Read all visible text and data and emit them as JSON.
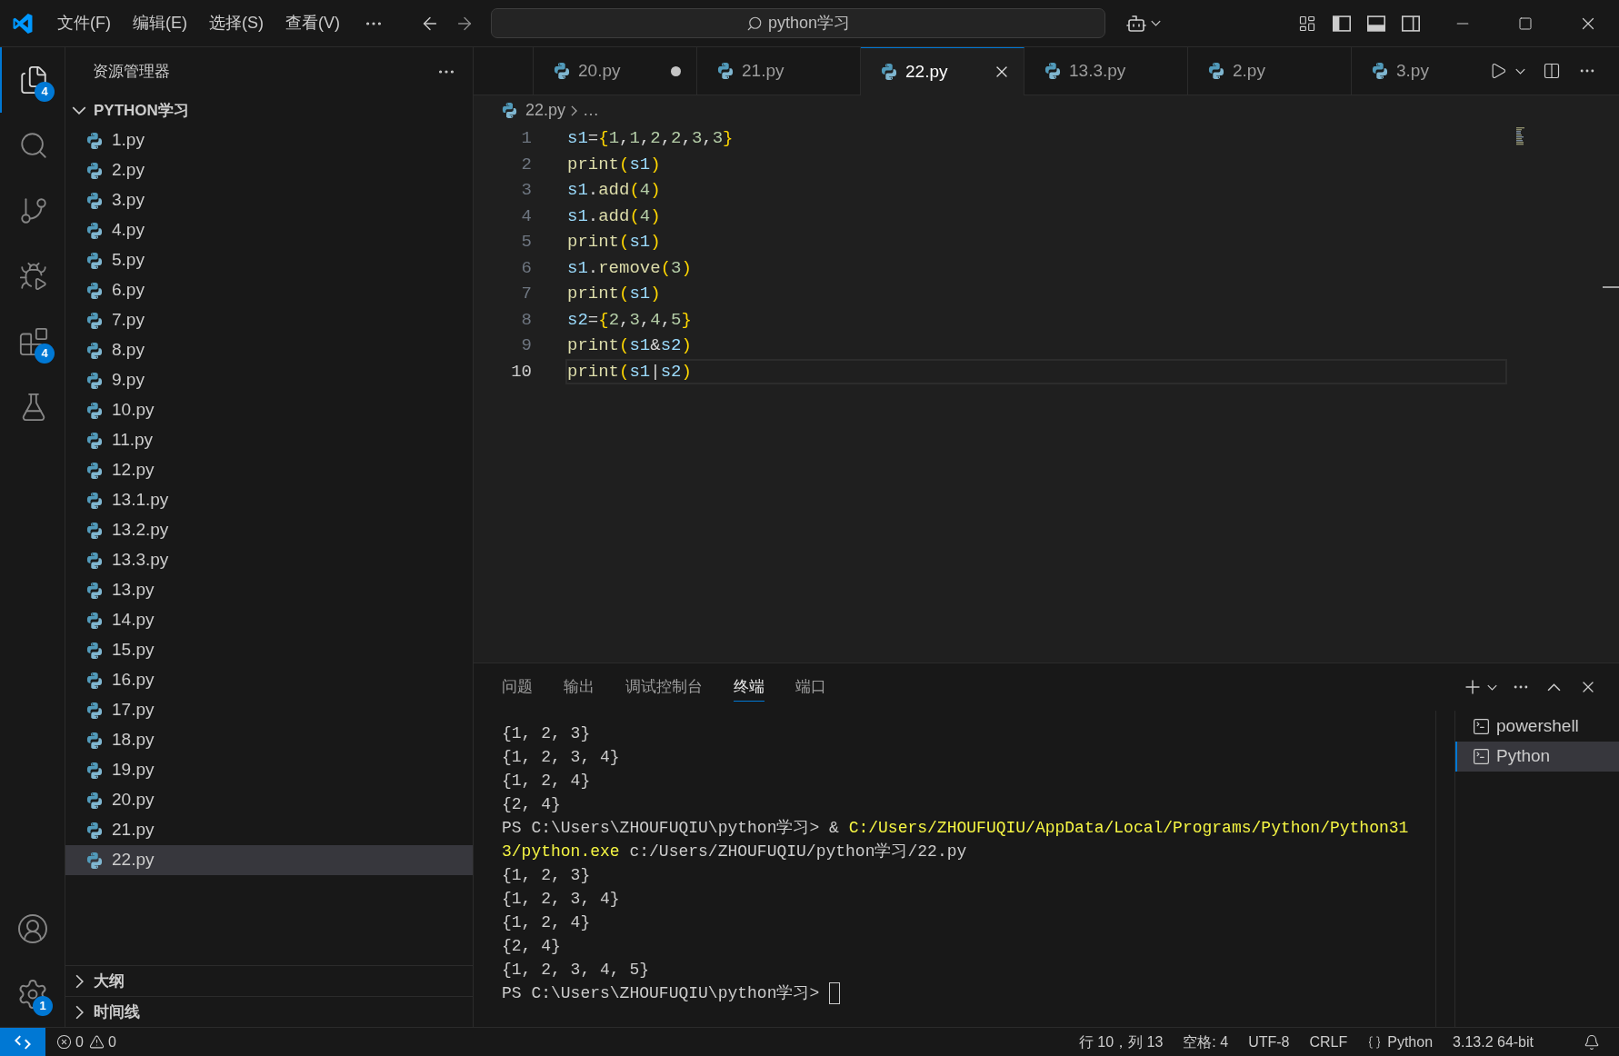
{
  "title_bar": {
    "menus": [
      "文件(F)",
      "编辑(E)",
      "选择(S)",
      "查看(V)"
    ],
    "command_center": {
      "label": "python学习"
    },
    "layout_toggles": {
      "primary_sidebar": true,
      "panel": true,
      "secondary_sidebar": false
    }
  },
  "activity_bar": {
    "items": [
      {
        "selected": true,
        "badge": "4"
      },
      {
        "selected": false
      },
      {
        "selected": false
      },
      {
        "selected": false
      },
      {
        "selected": false,
        "badge": "4"
      },
      {
        "selected": false
      }
    ],
    "settings_badge": "1"
  },
  "sidebar": {
    "title": "资源管理器",
    "folder": {
      "name": "PYTHON学习",
      "expanded": true,
      "children": [
        {
          "name": "1.py",
          "selected": false
        },
        {
          "name": "2.py",
          "selected": false
        },
        {
          "name": "3.py",
          "selected": false
        },
        {
          "name": "4.py",
          "selected": false
        },
        {
          "name": "5.py",
          "selected": false
        },
        {
          "name": "6.py",
          "selected": false
        },
        {
          "name": "7.py",
          "selected": false
        },
        {
          "name": "8.py",
          "selected": false
        },
        {
          "name": "9.py",
          "selected": false
        },
        {
          "name": "10.py",
          "selected": false
        },
        {
          "name": "11.py",
          "selected": false
        },
        {
          "name": "12.py",
          "selected": false
        },
        {
          "name": "13.1.py",
          "selected": false
        },
        {
          "name": "13.2.py",
          "selected": false
        },
        {
          "name": "13.3.py",
          "selected": false
        },
        {
          "name": "13.py",
          "selected": false
        },
        {
          "name": "14.py",
          "selected": false
        },
        {
          "name": "15.py",
          "selected": false
        },
        {
          "name": "16.py",
          "selected": false
        },
        {
          "name": "17.py",
          "selected": false
        },
        {
          "name": "18.py",
          "selected": false
        },
        {
          "name": "19.py",
          "selected": false
        },
        {
          "name": "20.py",
          "selected": false
        },
        {
          "name": "21.py",
          "selected": false
        },
        {
          "name": "22.py",
          "selected": true
        }
      ]
    },
    "sections": [
      {
        "label": "大纲",
        "expanded": false
      },
      {
        "label": "时间线",
        "expanded": false
      }
    ]
  },
  "editor": {
    "tabs": [
      {
        "label": "20.py",
        "selected": false,
        "dirty": true
      },
      {
        "label": "21.py",
        "selected": false,
        "dirty": false
      },
      {
        "label": "22.py",
        "selected": true,
        "dirty": false
      },
      {
        "label": "13.3.py",
        "selected": false,
        "dirty": false
      },
      {
        "label": "2.py",
        "selected": false,
        "dirty": false
      },
      {
        "label": "3.py",
        "selected": false
      }
    ],
    "breadcrumb": {
      "file": "22.py",
      "rest": "…"
    },
    "lines": [
      {
        "number": "1",
        "current": false,
        "tokens": [
          {
            "kind": "var",
            "text": "s1"
          },
          {
            "kind": "op",
            "text": "="
          },
          {
            "kind": "bracket",
            "text": "{"
          },
          {
            "kind": "num",
            "text": "1"
          },
          {
            "kind": "op",
            "text": ","
          },
          {
            "kind": "num",
            "text": "1"
          },
          {
            "kind": "op",
            "text": ","
          },
          {
            "kind": "num",
            "text": "2"
          },
          {
            "kind": "op",
            "text": ","
          },
          {
            "kind": "num",
            "text": "2"
          },
          {
            "kind": "op",
            "text": ","
          },
          {
            "kind": "num",
            "text": "3"
          },
          {
            "kind": "op",
            "text": ","
          },
          {
            "kind": "num",
            "text": "3"
          },
          {
            "kind": "bracket",
            "text": "}"
          }
        ]
      },
      {
        "number": "2",
        "current": false,
        "tokens": [
          {
            "kind": "func",
            "text": "print"
          },
          {
            "kind": "bracket",
            "text": "("
          },
          {
            "kind": "var",
            "text": "s1"
          },
          {
            "kind": "bracket",
            "text": ")"
          }
        ]
      },
      {
        "number": "3",
        "current": false,
        "tokens": [
          {
            "kind": "var",
            "text": "s1"
          },
          {
            "kind": "op",
            "text": "."
          },
          {
            "kind": "func",
            "text": "add"
          },
          {
            "kind": "bracket",
            "text": "("
          },
          {
            "kind": "num",
            "text": "4"
          },
          {
            "kind": "bracket",
            "text": ")"
          }
        ]
      },
      {
        "number": "4",
        "current": false,
        "tokens": [
          {
            "kind": "var",
            "text": "s1"
          },
          {
            "kind": "op",
            "text": "."
          },
          {
            "kind": "func",
            "text": "add"
          },
          {
            "kind": "bracket",
            "text": "("
          },
          {
            "kind": "num",
            "text": "4"
          },
          {
            "kind": "bracket",
            "text": ")"
          }
        ]
      },
      {
        "number": "5",
        "current": false,
        "tokens": [
          {
            "kind": "func",
            "text": "print"
          },
          {
            "kind": "bracket",
            "text": "("
          },
          {
            "kind": "var",
            "text": "s1"
          },
          {
            "kind": "bracket",
            "text": ")"
          }
        ]
      },
      {
        "number": "6",
        "current": false,
        "tokens": [
          {
            "kind": "var",
            "text": "s1"
          },
          {
            "kind": "op",
            "text": "."
          },
          {
            "kind": "func",
            "text": "remove"
          },
          {
            "kind": "bracket",
            "text": "("
          },
          {
            "kind": "num",
            "text": "3"
          },
          {
            "kind": "bracket",
            "text": ")"
          }
        ]
      },
      {
        "number": "7",
        "current": false,
        "tokens": [
          {
            "kind": "func",
            "text": "print"
          },
          {
            "kind": "bracket",
            "text": "("
          },
          {
            "kind": "var",
            "text": "s1"
          },
          {
            "kind": "bracket",
            "text": ")"
          }
        ]
      },
      {
        "number": "8",
        "current": false,
        "tokens": [
          {
            "kind": "var",
            "text": "s2"
          },
          {
            "kind": "op",
            "text": "="
          },
          {
            "kind": "bracket",
            "text": "{"
          },
          {
            "kind": "num",
            "text": "2"
          },
          {
            "kind": "op",
            "text": ","
          },
          {
            "kind": "num",
            "text": "3"
          },
          {
            "kind": "op",
            "text": ","
          },
          {
            "kind": "num",
            "text": "4"
          },
          {
            "kind": "op",
            "text": ","
          },
          {
            "kind": "num",
            "text": "5"
          },
          {
            "kind": "bracket",
            "text": "}"
          }
        ]
      },
      {
        "number": "9",
        "current": false,
        "tokens": [
          {
            "kind": "func",
            "text": "print"
          },
          {
            "kind": "bracket",
            "text": "("
          },
          {
            "kind": "var",
            "text": "s1"
          },
          {
            "kind": "op",
            "text": "&"
          },
          {
            "kind": "var",
            "text": "s2"
          },
          {
            "kind": "bracket",
            "text": ")"
          }
        ]
      },
      {
        "number": "10",
        "current": true,
        "tokens": [
          {
            "kind": "func",
            "text": "print"
          },
          {
            "kind": "bracket",
            "text": "("
          },
          {
            "kind": "var",
            "text": "s1"
          },
          {
            "kind": "op",
            "text": "|"
          },
          {
            "kind": "var",
            "text": "s2"
          },
          {
            "kind": "bracket",
            "text": ")"
          }
        ]
      }
    ]
  },
  "panel": {
    "tabs": [
      {
        "label": "问题",
        "selected": false
      },
      {
        "label": "输出",
        "selected": false
      },
      {
        "label": "调试控制台",
        "selected": false
      },
      {
        "label": "终端",
        "selected": true
      },
      {
        "label": "端口",
        "selected": false
      }
    ],
    "terminal": {
      "cursor": true,
      "lines": [
        {
          "segments": [
            {
              "kind": "plain",
              "text": "{1, 2, 3}"
            }
          ]
        },
        {
          "segments": [
            {
              "kind": "plain",
              "text": "{1, 2, 3, 4}"
            }
          ]
        },
        {
          "segments": [
            {
              "kind": "plain",
              "text": "{1, 2, 4}"
            }
          ]
        },
        {
          "segments": [
            {
              "kind": "plain",
              "text": "{2, 4}"
            }
          ]
        },
        {
          "segments": [
            {
              "kind": "plain",
              "text": "PS C:\\Users\\ZHOUFUQIU\\python学习> & "
            },
            {
              "kind": "command",
              "text": "C:/Users/ZHOUFUQIU/AppData/Local/Programs/Python/Python31"
            }
          ]
        },
        {
          "segments": [
            {
              "kind": "command",
              "text": "3/python.exe"
            },
            {
              "kind": "plain",
              "text": " c:/Users/ZHOUFUQIU/python学习/22.py"
            }
          ]
        },
        {
          "segments": [
            {
              "kind": "plain",
              "text": "{1, 2, 3}"
            }
          ]
        },
        {
          "segments": [
            {
              "kind": "plain",
              "text": "{1, 2, 3, 4}"
            }
          ]
        },
        {
          "segments": [
            {
              "kind": "plain",
              "text": "{1, 2, 4}"
            }
          ]
        },
        {
          "segments": [
            {
              "kind": "plain",
              "text": "{2, 4}"
            }
          ]
        },
        {
          "segments": [
            {
              "kind": "plain",
              "text": "{1, 2, 3, 4, 5}"
            }
          ]
        },
        {
          "segments": [
            {
              "kind": "plain",
              "text": "PS C:\\Users\\ZHOUFUQIU\\python学习> "
            }
          ]
        }
      ]
    },
    "sessions": [
      {
        "label": "powershell",
        "selected": false
      },
      {
        "label": "Python",
        "selected": true
      }
    ]
  },
  "status_bar": {
    "errors": "0",
    "warnings": "0",
    "items": [
      "行 10，列 13",
      "空格: 4",
      "UTF-8",
      "CRLF"
    ],
    "language": "Python",
    "interpreter": "3.13.2 64-bit"
  }
}
